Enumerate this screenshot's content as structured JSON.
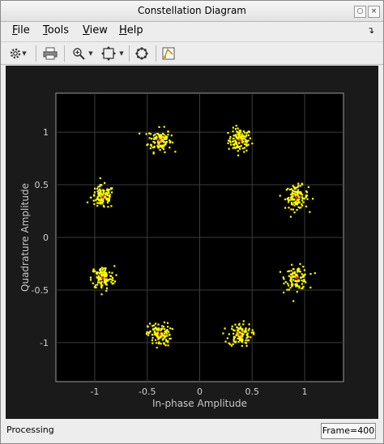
{
  "window": {
    "title": "Constellation Diagram"
  },
  "menu": [
    {
      "label": "File",
      "u": "F",
      "rest": "ile"
    },
    {
      "label": "Tools",
      "u": "T",
      "rest": "ools"
    },
    {
      "label": "View",
      "u": "V",
      "rest": "iew"
    },
    {
      "label": "Help",
      "u": "H",
      "rest": "elp"
    }
  ],
  "toolbar": {
    "icons": [
      "gear-icon",
      "print-icon",
      "zoom-in-icon",
      "fit-to-view-icon",
      "constellation-icon",
      "measurement-icon"
    ]
  },
  "chart_data": {
    "type": "scatter",
    "title": "",
    "xlabel": "In-phase Amplitude",
    "ylabel": "Quadrature Amplitude",
    "xlim": [
      -1.37,
      1.37
    ],
    "ylim": [
      -1.37,
      1.37
    ],
    "xticks": [
      "-1",
      "-0.5",
      "0",
      "0.5",
      "1"
    ],
    "yticks": [
      "1",
      "0.5",
      "0",
      "-0.5",
      "-1"
    ],
    "xtick_values": [
      -1,
      -0.5,
      0,
      0.5,
      1
    ],
    "ytick_values": [
      1,
      0.5,
      0,
      -0.5,
      -1
    ],
    "grid": true,
    "series": [
      {
        "marker_color": "#ffff00",
        "points_per_cluster": 110,
        "spread": 0.055
      }
    ],
    "reference_points": {
      "marker_color": "#ff2222",
      "points": [
        [
          0.383,
          0.924
        ],
        [
          -0.383,
          0.924
        ],
        [
          0.924,
          0.383
        ],
        [
          -0.924,
          0.383
        ],
        [
          0.924,
          -0.383
        ],
        [
          -0.924,
          -0.383
        ],
        [
          0.383,
          -0.924
        ],
        [
          -0.383,
          -0.924
        ]
      ]
    }
  },
  "status": {
    "left": "Processing",
    "frame": "Frame=400"
  }
}
